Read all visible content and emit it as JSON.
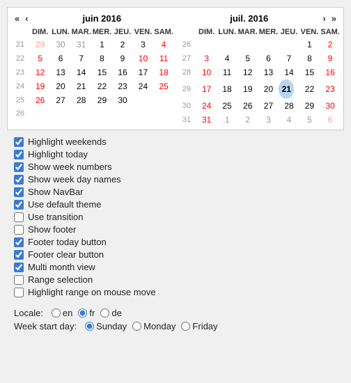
{
  "calendar": {
    "month1": {
      "title": "juin 2016",
      "dayHeaders": [
        "DIM.",
        "LUN.",
        "MAR.",
        "MER.",
        "JEU.",
        "VEN.",
        "SAM."
      ],
      "weeks": [
        {
          "wn": 21,
          "days": [
            {
              "d": "29",
              "cls": "other-month weekend"
            },
            {
              "d": "30",
              "cls": "other-month"
            },
            {
              "d": "31",
              "cls": "other-month"
            },
            {
              "d": "1",
              "cls": ""
            },
            {
              "d": "2",
              "cls": ""
            },
            {
              "d": "3",
              "cls": ""
            },
            {
              "d": "4",
              "cls": "weekend"
            }
          ]
        },
        {
          "wn": 22,
          "days": [
            {
              "d": "5",
              "cls": "weekend"
            },
            {
              "d": "6",
              "cls": ""
            },
            {
              "d": "7",
              "cls": ""
            },
            {
              "d": "8",
              "cls": ""
            },
            {
              "d": "9",
              "cls": ""
            },
            {
              "d": "10",
              "cls": "weekend-fri"
            },
            {
              "d": "11",
              "cls": "weekend"
            }
          ]
        },
        {
          "wn": 23,
          "days": [
            {
              "d": "12",
              "cls": "weekend"
            },
            {
              "d": "13",
              "cls": ""
            },
            {
              "d": "14",
              "cls": ""
            },
            {
              "d": "15",
              "cls": ""
            },
            {
              "d": "16",
              "cls": ""
            },
            {
              "d": "17",
              "cls": ""
            },
            {
              "d": "18",
              "cls": "weekend"
            }
          ]
        },
        {
          "wn": 24,
          "days": [
            {
              "d": "19",
              "cls": "weekend"
            },
            {
              "d": "20",
              "cls": ""
            },
            {
              "d": "21",
              "cls": ""
            },
            {
              "d": "22",
              "cls": ""
            },
            {
              "d": "23",
              "cls": ""
            },
            {
              "d": "24",
              "cls": ""
            },
            {
              "d": "25",
              "cls": "weekend"
            }
          ]
        },
        {
          "wn": 25,
          "days": [
            {
              "d": "26",
              "cls": "weekend"
            },
            {
              "d": "27",
              "cls": ""
            },
            {
              "d": "28",
              "cls": ""
            },
            {
              "d": "29",
              "cls": ""
            },
            {
              "d": "30",
              "cls": ""
            },
            {
              "d": "",
              "cls": ""
            },
            {
              "d": "",
              "cls": ""
            }
          ]
        },
        {
          "wn": 26,
          "days": [
            {
              "d": "",
              "cls": ""
            },
            {
              "d": "",
              "cls": ""
            },
            {
              "d": "",
              "cls": ""
            },
            {
              "d": "",
              "cls": ""
            },
            {
              "d": "",
              "cls": ""
            },
            {
              "d": "",
              "cls": ""
            },
            {
              "d": "",
              "cls": ""
            }
          ]
        }
      ]
    },
    "month2": {
      "title": "juil. 2016",
      "dayHeaders": [
        "DIM.",
        "LUN.",
        "MAR.",
        "MER.",
        "JEU.",
        "VEN.",
        "SAM."
      ],
      "weeks": [
        {
          "wn": 26,
          "days": [
            {
              "d": "",
              "cls": ""
            },
            {
              "d": "",
              "cls": ""
            },
            {
              "d": "",
              "cls": ""
            },
            {
              "d": "",
              "cls": ""
            },
            {
              "d": "",
              "cls": ""
            },
            {
              "d": "1",
              "cls": ""
            },
            {
              "d": "2",
              "cls": "weekend"
            }
          ]
        },
        {
          "wn": 27,
          "days": [
            {
              "d": "3",
              "cls": "weekend"
            },
            {
              "d": "4",
              "cls": ""
            },
            {
              "d": "5",
              "cls": ""
            },
            {
              "d": "6",
              "cls": ""
            },
            {
              "d": "7",
              "cls": ""
            },
            {
              "d": "8",
              "cls": ""
            },
            {
              "d": "9",
              "cls": "weekend"
            }
          ]
        },
        {
          "wn": 28,
          "days": [
            {
              "d": "10",
              "cls": "weekend"
            },
            {
              "d": "11",
              "cls": ""
            },
            {
              "d": "12",
              "cls": ""
            },
            {
              "d": "13",
              "cls": ""
            },
            {
              "d": "14",
              "cls": ""
            },
            {
              "d": "15",
              "cls": ""
            },
            {
              "d": "16",
              "cls": "weekend"
            }
          ]
        },
        {
          "wn": 29,
          "days": [
            {
              "d": "17",
              "cls": "weekend"
            },
            {
              "d": "18",
              "cls": ""
            },
            {
              "d": "19",
              "cls": ""
            },
            {
              "d": "20",
              "cls": ""
            },
            {
              "d": "21",
              "cls": "today"
            },
            {
              "d": "22",
              "cls": ""
            },
            {
              "d": "23",
              "cls": "weekend"
            }
          ]
        },
        {
          "wn": 30,
          "days": [
            {
              "d": "24",
              "cls": "weekend"
            },
            {
              "d": "25",
              "cls": ""
            },
            {
              "d": "26",
              "cls": ""
            },
            {
              "d": "27",
              "cls": ""
            },
            {
              "d": "28",
              "cls": ""
            },
            {
              "d": "29",
              "cls": ""
            },
            {
              "d": "30",
              "cls": "weekend"
            }
          ]
        },
        {
          "wn": 31,
          "days": [
            {
              "d": "31",
              "cls": "weekend"
            },
            {
              "d": "1",
              "cls": "other-month"
            },
            {
              "d": "2",
              "cls": "other-month"
            },
            {
              "d": "3",
              "cls": "other-month"
            },
            {
              "d": "4",
              "cls": "other-month"
            },
            {
              "d": "5",
              "cls": "other-month"
            },
            {
              "d": "6",
              "cls": "other-month"
            }
          ]
        }
      ]
    }
  },
  "checkboxes": [
    {
      "id": "chk1",
      "label": "Highlight weekends",
      "checked": true
    },
    {
      "id": "chk2",
      "label": "Highlight today",
      "checked": true
    },
    {
      "id": "chk3",
      "label": "Show week numbers",
      "checked": true
    },
    {
      "id": "chk4",
      "label": "Show week day names",
      "checked": true
    },
    {
      "id": "chk5",
      "label": "Show NavBar",
      "checked": true
    },
    {
      "id": "chk6",
      "label": "Use default theme",
      "checked": true
    },
    {
      "id": "chk7",
      "label": "Use transition",
      "checked": false
    },
    {
      "id": "chk8",
      "label": "Show footer",
      "checked": false
    },
    {
      "id": "chk9",
      "label": "Footer today button",
      "checked": true
    },
    {
      "id": "chk10",
      "label": "Footer clear button",
      "checked": true
    },
    {
      "id": "chk11",
      "label": "Multi month view",
      "checked": true
    },
    {
      "id": "chk12",
      "label": "Range selection",
      "checked": false
    },
    {
      "id": "chk13",
      "label": "Highlight range on mouse move",
      "checked": false
    }
  ],
  "locale": {
    "label": "Locale:",
    "options": [
      "en",
      "fr",
      "de"
    ],
    "selected": "fr"
  },
  "weekStart": {
    "label": "Week start day:",
    "options": [
      "Sunday",
      "Monday",
      "Friday"
    ],
    "selected": "Sunday"
  },
  "nav": {
    "prevprev": "«",
    "prev": "‹",
    "next": "›",
    "nextnext": "»"
  }
}
